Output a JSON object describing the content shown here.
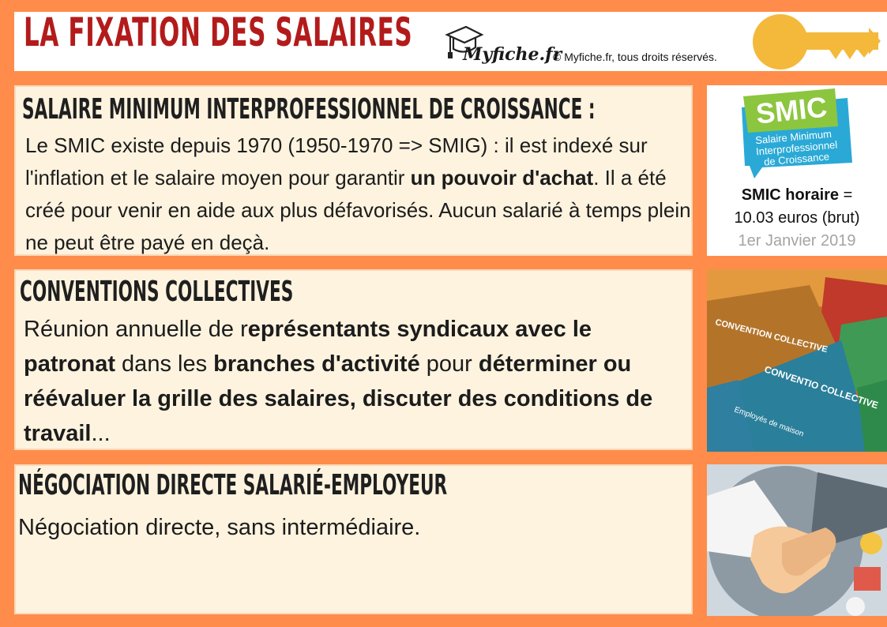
{
  "header": {
    "title": "LA FIXATION DES SALAIRES",
    "logo_text": "Myfiche.fr",
    "copyright": "© Myfiche.fr, tous droits réservés."
  },
  "smic_section": {
    "heading": "SALAIRE MINIMUM INTERPROFESSIONNEL DE CROISSANCE :",
    "text_1": "Le SMIC existe depuis 1970 (1950-1970 => SMIG) : il est indexé sur l'inflation et le salaire moyen pour garantir ",
    "text_bold": "un pouvoir d'achat",
    "text_2": ". Il a été créé pour venir en aide aux plus défavorisés. Aucun salarié à temps plein ne peut être payé en deçà."
  },
  "smic_card": {
    "badge_title": "SMIC",
    "badge_sub_1": "Salaire Minimum",
    "badge_sub_2": "Interprofessionnel",
    "badge_sub_3": "de Croissance",
    "rate_label": "SMIC horaire",
    "rate_eq": " =",
    "rate_value": "10.03 euros (brut)",
    "date": "1er Janvier 2019"
  },
  "conventions_section": {
    "heading": "CONVENTIONS COLLECTIVES",
    "t1": "Réunion annuelle de r",
    "b1": "eprésentants syndicaux avec le patronat",
    "t2": " dans les ",
    "b2": "branches d'activité",
    "t3": " pour ",
    "b3": "déterminer ou réévaluer la grille des salaires, discuter des conditions de travail",
    "t4": "..."
  },
  "conventions_image": {
    "book_label_1": "CONVENTION COLLECTIVE",
    "book_label_2": "CONVENTIO COLLECTIVE",
    "book_sub": "Employés de maison"
  },
  "negociation_section": {
    "heading": "NÉGOCIATION DIRECTE SALARIÉ-EMPLOYEUR",
    "text": "Négociation directe, sans intermédiaire."
  },
  "colors": {
    "background": "#ff8c4a",
    "title_red": "#b31b1b",
    "panel_bg": "#fdf3df",
    "key_yellow": "#f4b93b",
    "smic_blue": "#2aa9d6",
    "smic_green": "#8cc63f"
  },
  "icons": [
    "graduation-cap-icon",
    "key-icon",
    "handshake-icon"
  ]
}
